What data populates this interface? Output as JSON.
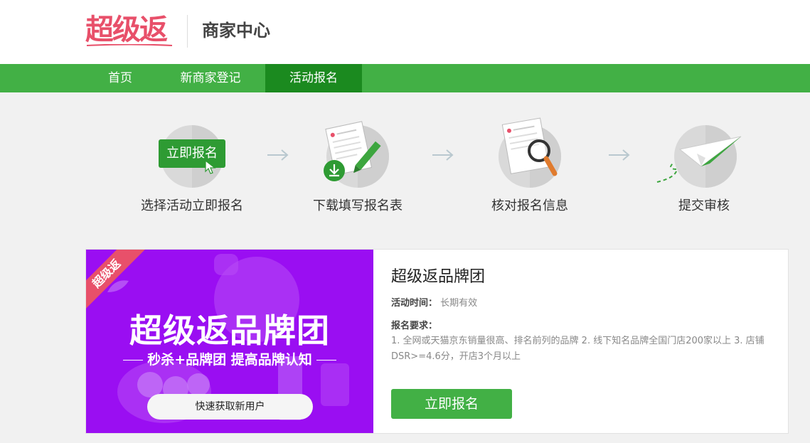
{
  "header": {
    "logo": "超级返",
    "title": "商家中心"
  },
  "nav": {
    "items": [
      {
        "label": "首页"
      },
      {
        "label": "新商家登记"
      },
      {
        "label": "活动报名"
      }
    ],
    "active": "活动报名"
  },
  "steps": [
    {
      "label": "选择活动立即报名",
      "icon": "apply-button-icon",
      "badge": "立即报名"
    },
    {
      "label": "下载填写报名表",
      "icon": "download-form-icon"
    },
    {
      "label": "核对报名信息",
      "icon": "magnifier-document-icon"
    },
    {
      "label": "提交审核",
      "icon": "paper-plane-icon"
    }
  ],
  "activity": {
    "banner": {
      "ribbon": "超级返",
      "title": "超级返品牌团",
      "subtitle": "秒杀+品牌团 提高品牌认知",
      "button": "快速获取新用户"
    },
    "title": "超级返品牌团",
    "time_label": "活动时间：",
    "time_value": "长期有效",
    "req_label": "报名要求：",
    "requirements": "1. 全网或天猫京东销量很高、排名前列的品牌 2. 线下知名品牌全国门店200家以上 3. 店铺DSR>=4.6分，开店3个月以上",
    "apply_button": "立即报名"
  },
  "colors": {
    "brand_red": "#e8506a",
    "nav_green": "#42b045",
    "nav_active": "#1b8a1f",
    "banner_purple": "#9a0ef2"
  }
}
